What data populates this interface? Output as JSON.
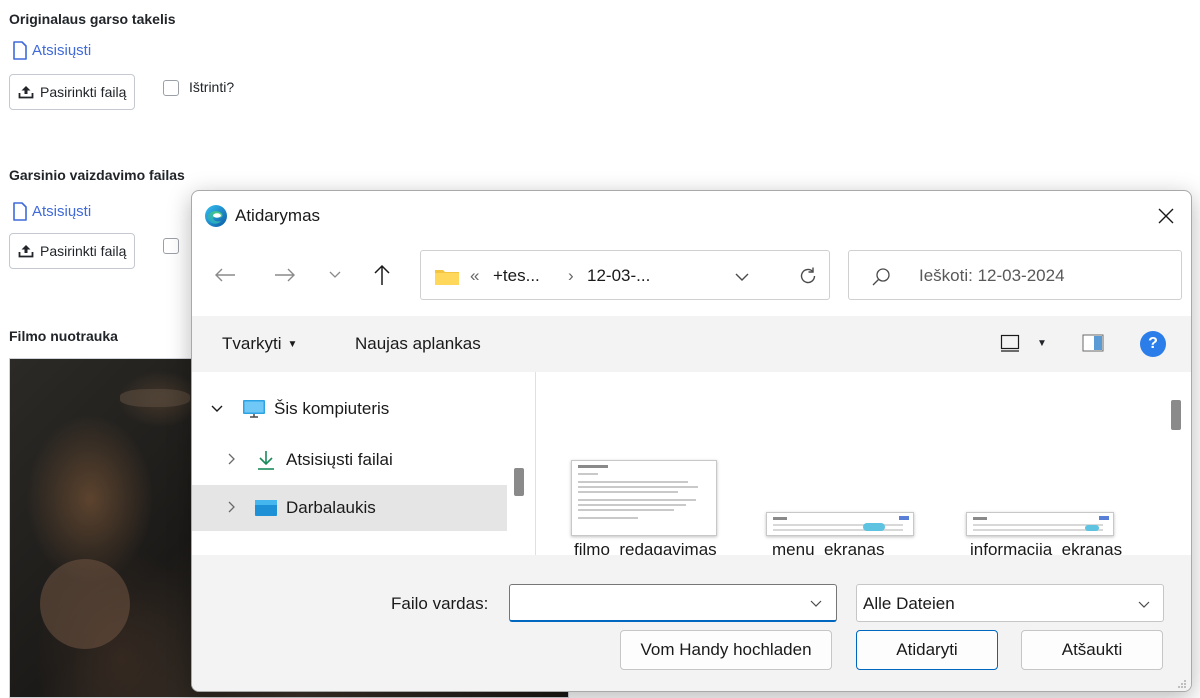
{
  "form": {
    "section1": {
      "label": "Originalaus garso takelis",
      "download": "Atsisiųsti",
      "choose_file": "Pasirinkti failą",
      "delete": "Ištrinti?"
    },
    "section2": {
      "label": "Garsinio vaizdavimo failas",
      "download": "Atsisiųsti",
      "choose_file": "Pasirinkti failą"
    },
    "section3": {
      "label": "Filmo nuotrauka"
    }
  },
  "dialog": {
    "title": "Atidarymas",
    "breadcrumb": [
      "«",
      "+tes...",
      "›",
      "12-03-..."
    ],
    "search_placeholder": "Ieškoti: 12-03-2024",
    "toolbar": {
      "organize": "Tvarkyti",
      "new_folder": "Naujas aplankas"
    },
    "tree": [
      {
        "label": "Šis kompiuteris",
        "icon": "computer-icon",
        "expanded": true
      },
      {
        "label": "Atsisiųsti failai",
        "icon": "download-arrow-icon"
      },
      {
        "label": "Darbalaukis",
        "icon": "desktop-folder-icon",
        "selected": true
      }
    ],
    "files": [
      "filmo_redagavimas",
      "menu_ekranas",
      "informacija_ekranas"
    ],
    "file_name_label": "Failo vardas:",
    "file_name_value": "",
    "file_type": "Alle Dateien",
    "buttons": {
      "upload_phone": "Vom Handy hochladen",
      "open": "Atidaryti",
      "cancel": "Atšaukti"
    },
    "colors": {
      "accent": "#0067c0",
      "help": "#2b7de9",
      "link": "#3f6ad8"
    }
  }
}
